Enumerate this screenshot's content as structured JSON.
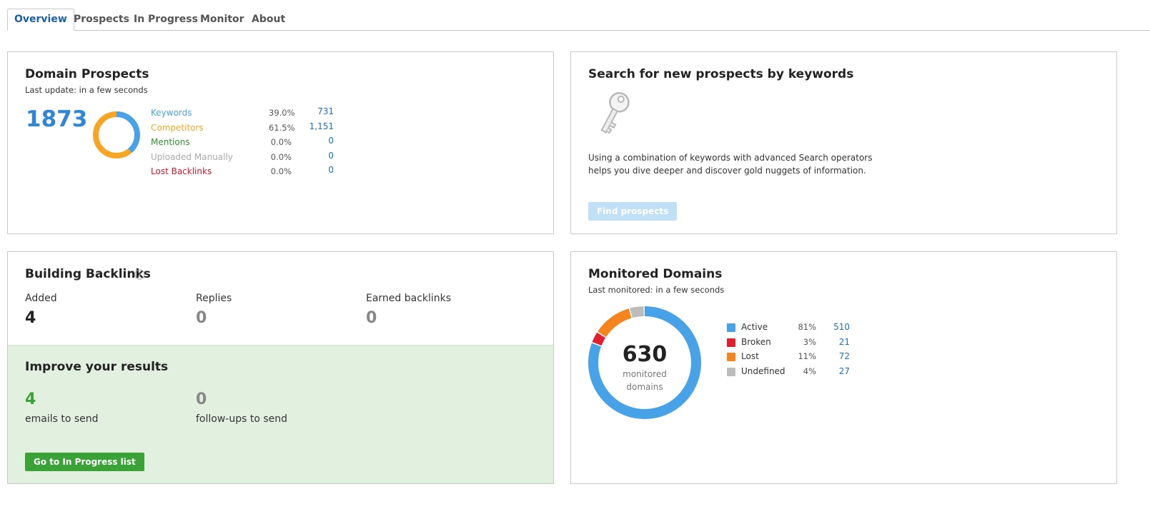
{
  "tabs": [
    {
      "label": "Overview"
    },
    {
      "label": "Prospects"
    },
    {
      "label": "In Progress"
    },
    {
      "label": "Monitor"
    },
    {
      "label": "About"
    }
  ],
  "domain_prospects": {
    "title": "Domain Prospects",
    "subtitle": "Last update: in a few seconds",
    "total": "1873",
    "rows": [
      {
        "label": "Keywords",
        "percent": "39.0%",
        "count": "731",
        "color": "#47a2e8"
      },
      {
        "label": "Competitors",
        "percent": "61.5%",
        "count": "1,151",
        "color": "#f8a523"
      },
      {
        "label": "Mentions",
        "percent": "0.0%",
        "count": "0",
        "color": "#2f8f2f"
      },
      {
        "label": "Uploaded Manually",
        "percent": "0.0%",
        "count": "0",
        "color": "#a9a9a9"
      },
      {
        "label": "Lost Backlinks",
        "percent": "0.0%",
        "count": "0",
        "color": "#d0182b"
      }
    ]
  },
  "search_prospects": {
    "title": "Search for new prospects by keywords",
    "description": "Using a combination of keywords with advanced Search operators helps you dive deeper and discover gold nuggets of information.",
    "button": "Find prospects",
    "icon": "key-icon"
  },
  "building_backlinks": {
    "title": "Building Backlinks",
    "info_icon": "info-icon",
    "stats": [
      {
        "label": "Added",
        "value": "4"
      },
      {
        "label": "Replies",
        "value": "0"
      },
      {
        "label": "Earned backlinks",
        "value": "0"
      }
    ],
    "improve": {
      "title": "Improve your results",
      "items": [
        {
          "value": "4",
          "label": "emails to send"
        },
        {
          "value": "0",
          "label": "follow-ups to send"
        }
      ],
      "button": "Go to In Progress list"
    }
  },
  "monitored_domains": {
    "title": "Monitored Domains",
    "subtitle": "Last monitored: in a few seconds",
    "total": "630",
    "total_label_1": "monitored",
    "total_label_2": "domains",
    "rows": [
      {
        "label": "Active",
        "percent": "81%",
        "count": "510",
        "color": "#47a2e8"
      },
      {
        "label": "Broken",
        "percent": "3%",
        "count": "21",
        "color": "#e0202e"
      },
      {
        "label": "Lost",
        "percent": "11%",
        "count": "72",
        "color": "#f5841f"
      },
      {
        "label": "Undefined",
        "percent": "4%",
        "count": "27",
        "color": "#bcbcbc"
      }
    ]
  },
  "colors": {
    "accent_blue": "#2f86d9",
    "green": "#3aa236",
    "green_value": "#3aa236",
    "gray_value": "#888888"
  }
}
